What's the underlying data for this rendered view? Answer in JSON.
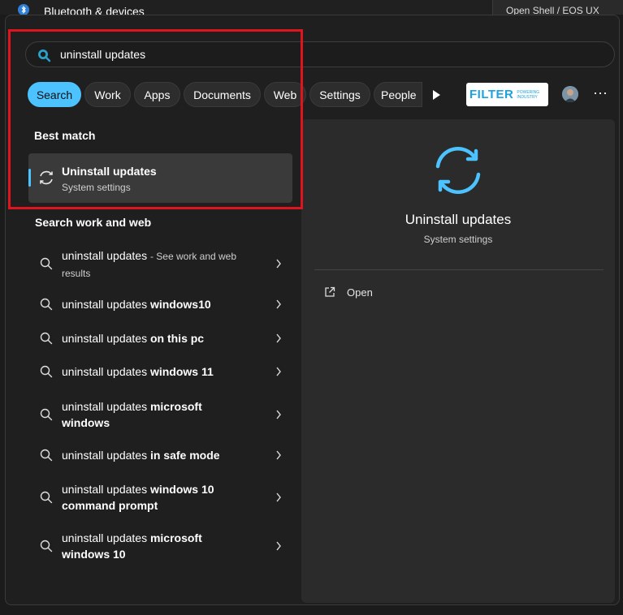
{
  "background_window": {
    "title": "Bluetooth & devices",
    "right_text": "Open Shell / EOS UX"
  },
  "search": {
    "query": "uninstall updates"
  },
  "filters": [
    {
      "label": "Search",
      "active": true
    },
    {
      "label": "Work"
    },
    {
      "label": "Apps"
    },
    {
      "label": "Documents"
    },
    {
      "label": "Web"
    },
    {
      "label": "Settings"
    },
    {
      "label": "People"
    }
  ],
  "filter_logo": {
    "brand": "FILTER",
    "tagline": "POWERING INDUSTRY"
  },
  "best_match": {
    "heading": "Best match",
    "title": "Uninstall updates",
    "subtitle": "System settings",
    "icon": "refresh-icon"
  },
  "web_section": {
    "heading": "Search work and web",
    "results": [
      {
        "query": "uninstall updates",
        "bold": "",
        "hint": "- See work and web results"
      },
      {
        "query": "uninstall updates",
        "bold": "windows10",
        "hint": ""
      },
      {
        "query": "uninstall updates",
        "bold": "on this pc",
        "hint": ""
      },
      {
        "query": "uninstall updates",
        "bold": "windows 11",
        "hint": ""
      },
      {
        "query": "uninstall updates",
        "bold": "microsoft windows",
        "hint": ""
      },
      {
        "query": "uninstall updates",
        "bold": "in safe mode",
        "hint": ""
      },
      {
        "query": "uninstall updates",
        "bold": "windows 10 command prompt",
        "hint": ""
      },
      {
        "query": "uninstall updates",
        "bold": "microsoft windows 10",
        "hint": ""
      }
    ]
  },
  "preview": {
    "title": "Uninstall updates",
    "subtitle": "System settings",
    "actions": [
      {
        "label": "Open",
        "icon": "open-external-icon"
      }
    ]
  },
  "colors": {
    "accent": "#4cc2ff",
    "highlight": "#e0141e"
  }
}
